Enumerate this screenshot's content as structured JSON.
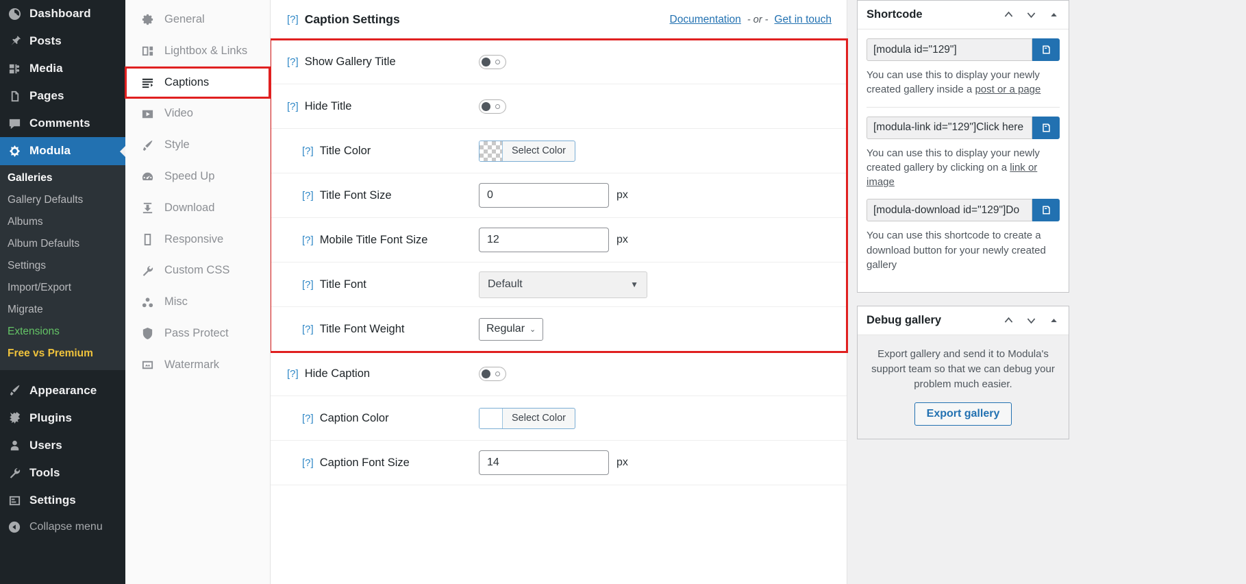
{
  "wp_sidebar": {
    "items": [
      {
        "label": "Dashboard",
        "icon": "dashboard-icon"
      },
      {
        "label": "Posts",
        "icon": "posts-pin-icon"
      },
      {
        "label": "Media",
        "icon": "media-icon"
      },
      {
        "label": "Pages",
        "icon": "pages-icon"
      },
      {
        "label": "Comments",
        "icon": "comments-icon"
      },
      {
        "label": "Modula",
        "icon": "modula-icon",
        "active": true
      }
    ],
    "submenu": [
      {
        "label": "Galleries",
        "state": "current"
      },
      {
        "label": "Gallery Defaults",
        "state": "normal"
      },
      {
        "label": "Albums",
        "state": "normal"
      },
      {
        "label": "Album Defaults",
        "state": "normal"
      },
      {
        "label": "Settings",
        "state": "normal"
      },
      {
        "label": "Import/Export",
        "state": "normal"
      },
      {
        "label": "Migrate",
        "state": "normal"
      },
      {
        "label": "Extensions",
        "state": "green"
      },
      {
        "label": "Free vs Premium",
        "state": "gold"
      }
    ],
    "items_bottom": [
      {
        "label": "Appearance",
        "icon": "appearance-brush-icon"
      },
      {
        "label": "Plugins",
        "icon": "plugins-plug-icon"
      },
      {
        "label": "Users",
        "icon": "users-icon"
      },
      {
        "label": "Tools",
        "icon": "tools-wrench-icon"
      },
      {
        "label": "Settings",
        "icon": "settings-sliders-icon"
      }
    ],
    "collapse_label": "Collapse menu"
  },
  "tabs": [
    {
      "label": "General",
      "icon": "gear-icon"
    },
    {
      "label": "Lightbox & Links",
      "icon": "lightbox-icon"
    },
    {
      "label": "Captions",
      "icon": "captions-lines-icon",
      "selected": true
    },
    {
      "label": "Video",
      "icon": "video-play-icon"
    },
    {
      "label": "Style",
      "icon": "style-brush-icon"
    },
    {
      "label": "Speed Up",
      "icon": "speed-gauge-icon"
    },
    {
      "label": "Download",
      "icon": "download-icon"
    },
    {
      "label": "Responsive",
      "icon": "responsive-device-icon"
    },
    {
      "label": "Custom CSS",
      "icon": "wrench-icon"
    },
    {
      "label": "Misc",
      "icon": "misc-dots-icon"
    },
    {
      "label": "Pass Protect",
      "icon": "shield-icon"
    },
    {
      "label": "Watermark",
      "icon": "watermark-image-icon"
    }
  ],
  "panel": {
    "title": "Caption Settings",
    "help_glyph": "[?]",
    "documentation_label": "Documentation",
    "separator": "- or -",
    "get_in_touch_label": "Get in touch"
  },
  "settings": {
    "highlighted_rows": [
      {
        "label": "Show Gallery Title",
        "type": "toggle",
        "value": "off",
        "indent": false,
        "name": "show-gallery-title"
      },
      {
        "label": "Hide Title",
        "type": "toggle",
        "value": "off",
        "indent": false,
        "name": "hide-title"
      },
      {
        "label": "Title Color",
        "type": "color",
        "swatch": "transparent",
        "button_label": "Select Color",
        "indent": true,
        "name": "title-color"
      },
      {
        "label": "Title Font Size",
        "type": "number",
        "value": "0",
        "unit": "px",
        "indent": true,
        "name": "title-font-size"
      },
      {
        "label": "Mobile Title Font Size",
        "type": "number",
        "value": "12",
        "unit": "px",
        "indent": true,
        "name": "mobile-title-font-size"
      },
      {
        "label": "Title Font",
        "type": "select-big",
        "value": "Default",
        "indent": true,
        "name": "title-font"
      },
      {
        "label": "Title Font Weight",
        "type": "select-small",
        "value": "Regular",
        "indent": true,
        "name": "title-font-weight"
      }
    ],
    "rows_after": [
      {
        "label": "Hide Caption",
        "type": "toggle",
        "value": "off",
        "indent": false,
        "name": "hide-caption"
      },
      {
        "label": "Caption Color",
        "type": "color",
        "swatch": "white",
        "button_label": "Select Color",
        "indent": true,
        "name": "caption-color"
      },
      {
        "label": "Caption Font Size",
        "type": "number",
        "value": "14",
        "unit": "px",
        "indent": true,
        "name": "caption-font-size"
      }
    ]
  },
  "shortcode_box": {
    "title": "Shortcode",
    "entries": [
      {
        "value": "[modula id=\"129\"]",
        "desc_before": "You can use this to display your newly created gallery inside a ",
        "desc_link": "post or a page",
        "desc_after": ""
      },
      {
        "value": "[modula-link id=\"129\"]Click here",
        "desc_before": "You can use this to display your newly created gallery by clicking on a ",
        "desc_link": "link or image",
        "desc_after": ""
      },
      {
        "value": "[modula-download id=\"129\"]Do",
        "desc_before": "You can use this shortcode to create a download button for your newly created gallery",
        "desc_link": "",
        "desc_after": ""
      }
    ]
  },
  "debug_box": {
    "title": "Debug gallery",
    "text": "Export gallery and send it to Modula's support team so that we can debug your problem much easier.",
    "button_label": "Export gallery"
  },
  "colors": {
    "wp_admin_bg": "#1d2327",
    "wp_submenu_bg": "#2c3338",
    "accent_blue": "#2271b1",
    "highlight_red": "#e02020",
    "link_blue": "#2271b1",
    "extensions_green": "#64c366",
    "premium_gold": "#f0c33c"
  }
}
